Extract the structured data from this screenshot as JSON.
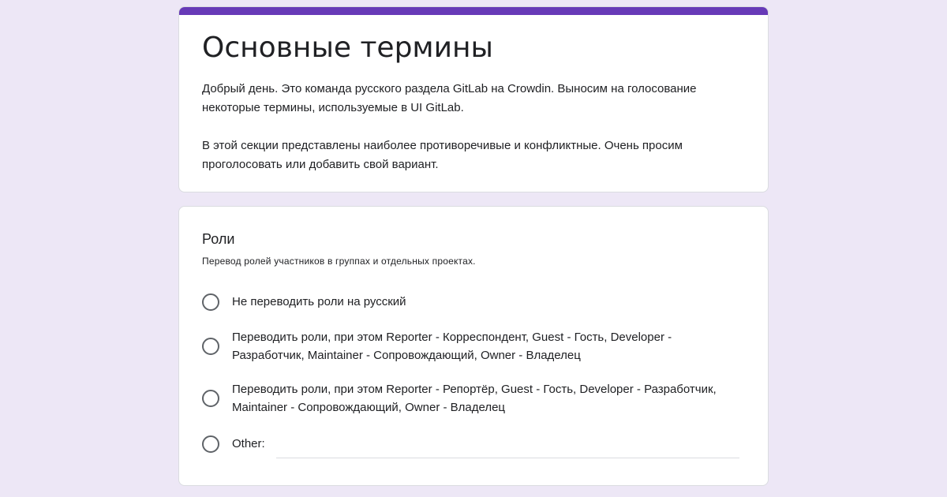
{
  "colors": {
    "background": "#ede7f6",
    "accent": "#673ab7",
    "card": "#ffffff"
  },
  "form": {
    "title": "Основные термины",
    "description": [
      "Добрый день. Это команда русского раздела GitLab на Crowdin. Выносим на голосование некоторые термины, используемые в UI GitLab.",
      "В этой секции представлены наиболее противоречивые и конфликтные. Очень просим проголосовать или добавить свой вариант."
    ]
  },
  "question": {
    "title": "Роли",
    "description": "Перевод ролей участников в группах и отдельных проектах.",
    "options": [
      {
        "label": "Не переводить роли на русский",
        "selected": false
      },
      {
        "label": "Переводить роли, при этом Reporter - Корреспондент, Guest - Гость, Developer - Разработчик, Maintainer - Сопровождающий, Owner - Владелец",
        "selected": false
      },
      {
        "label": "Переводить роли, при этом Reporter - Репортёр, Guest - Гость, Developer - Разработчик, Maintainer - Сопровождающий, Owner - Владелец",
        "selected": false
      }
    ],
    "other": {
      "label": "Other:",
      "value": ""
    }
  }
}
